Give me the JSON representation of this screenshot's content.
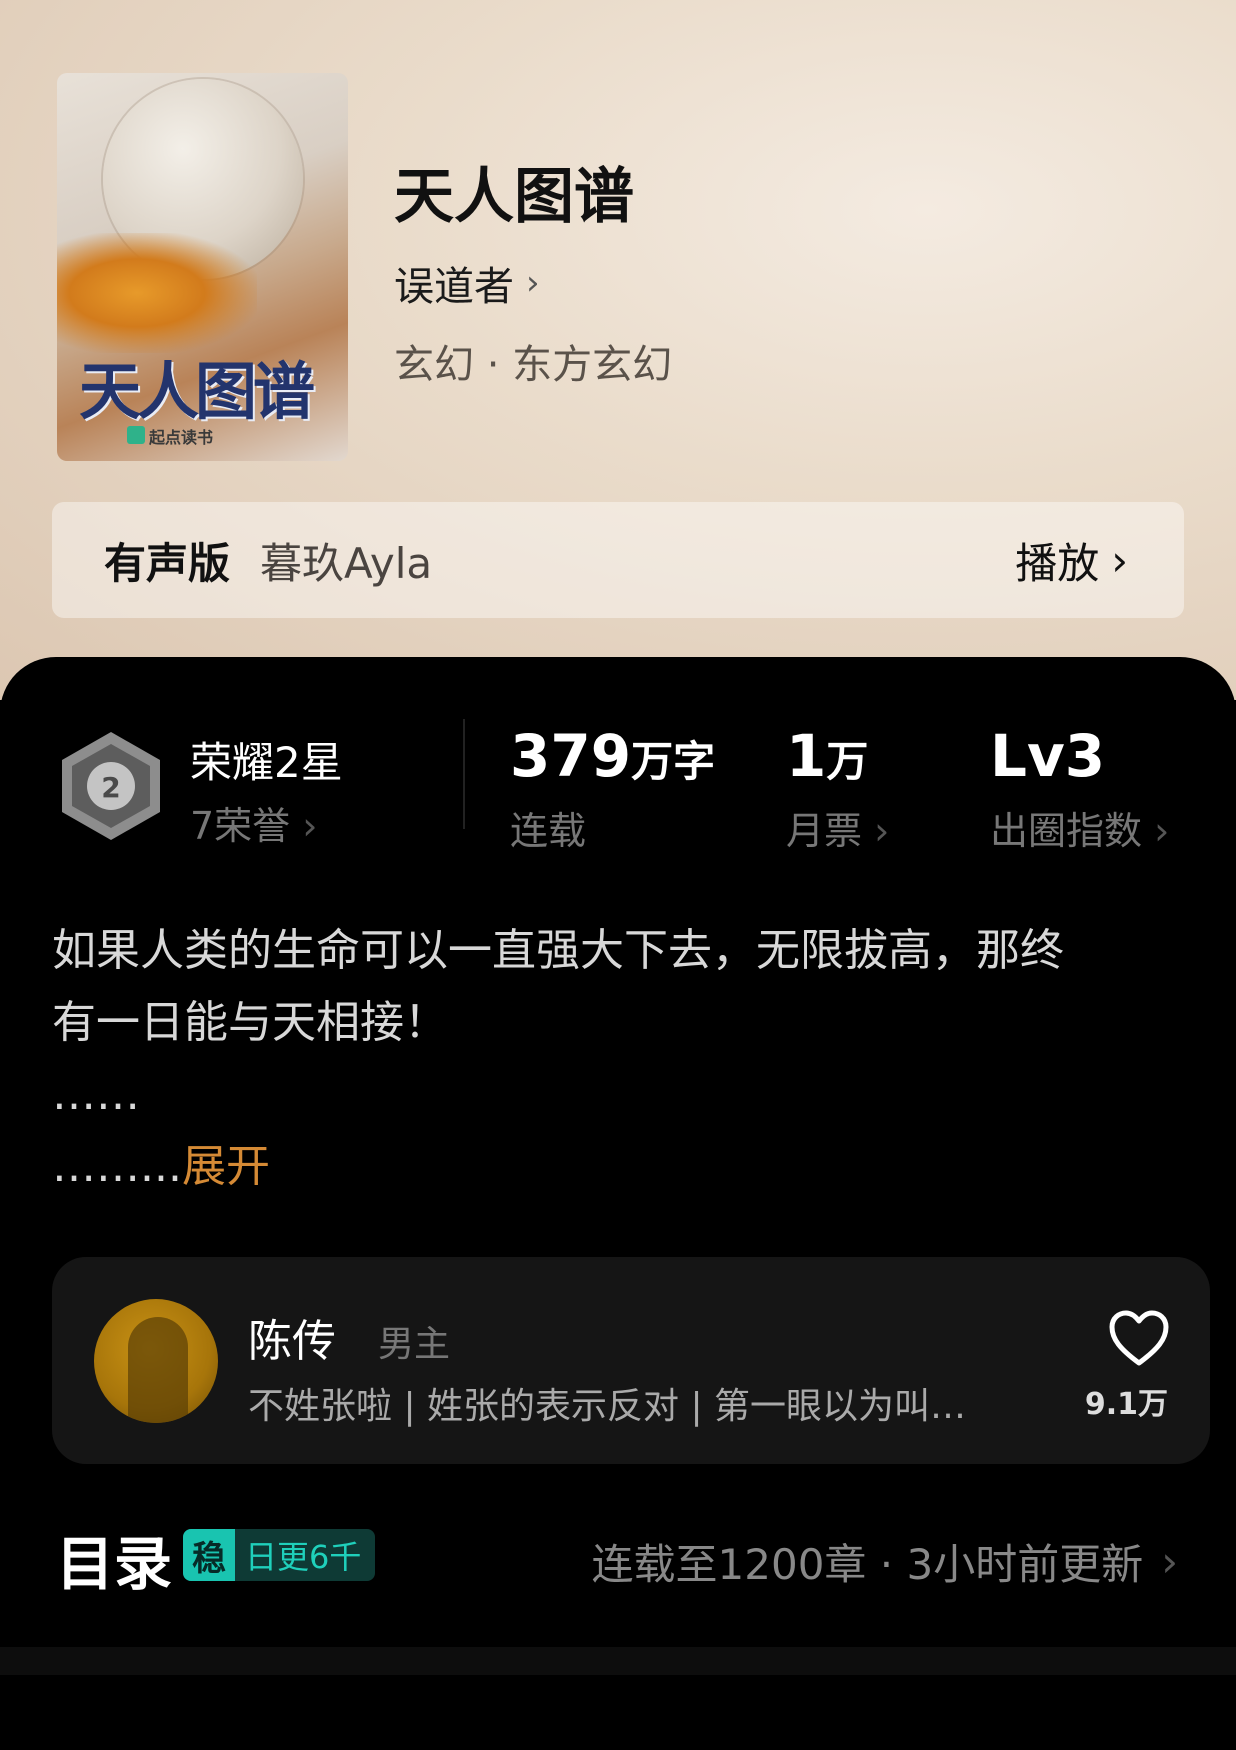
{
  "book": {
    "title": "天人图谱",
    "author": "误道者",
    "category": "玄幻 · 东方玄幻",
    "cover": {
      "title": "天人图谱",
      "publisher": "起点读书"
    }
  },
  "audio": {
    "label": "有声版",
    "narrator": "暮玖Ayla",
    "play_label": "播放"
  },
  "stats": {
    "honor_title": "荣耀2星",
    "honor_sub": "7荣誉",
    "words_num": "379",
    "words_unit": "万字",
    "words_label": "连载",
    "tickets_num": "1",
    "tickets_unit": "万",
    "tickets_label": "月票",
    "index_value": "Lv3",
    "index_label": "出圈指数"
  },
  "synopsis": {
    "line1": "如果人类的生命可以一直强大下去，无限拔高，那终",
    "line2": "有一日能与天相接！",
    "line3": "……",
    "line4_prefix": "……...",
    "expand_label": "展开"
  },
  "character": {
    "name": "陈传",
    "role": "男主",
    "description": "不姓张啦 | 姓张的表示反对 | 第一眼以为叫…",
    "likes": "9.1万"
  },
  "toc": {
    "title": "目录",
    "badge_stamp": "稳",
    "badge_text": "日更6千",
    "info": "连载至1200章 · 3小时前更新"
  },
  "colors": {
    "accent_expand": "#d58a35",
    "badge_teal": "#19c4b0"
  }
}
